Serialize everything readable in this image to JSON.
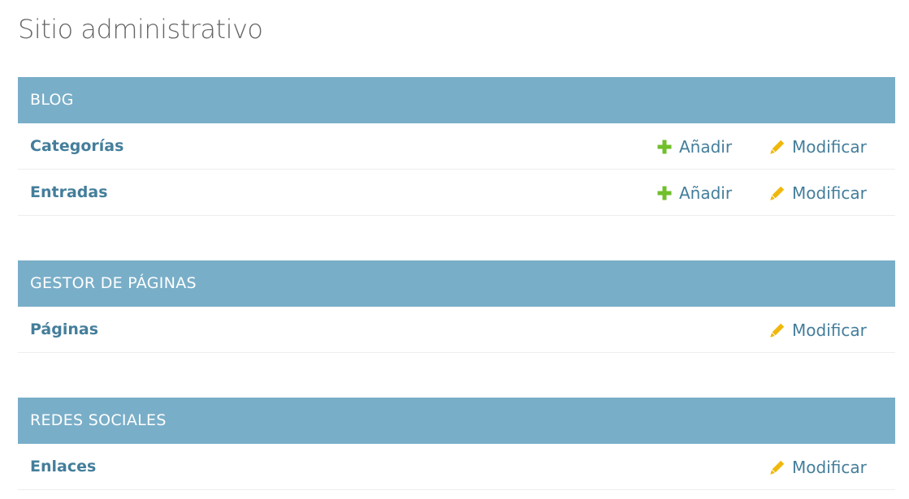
{
  "page": {
    "title": "Sitio administrativo"
  },
  "icons": {
    "add": "plus-icon",
    "change": "pencil-icon"
  },
  "colors": {
    "header_bg": "#79aec8",
    "header_text": "#ffffff",
    "link": "#447e9b",
    "add_icon": "#70bf2b",
    "change_icon": "#efb80b",
    "title": "#666666"
  },
  "modules": [
    {
      "name": "BLOG",
      "models": [
        {
          "name": "Categorías",
          "add_label": "Añadir",
          "change_label": "Modificar"
        },
        {
          "name": "Entradas",
          "add_label": "Añadir",
          "change_label": "Modificar"
        }
      ]
    },
    {
      "name": "GESTOR DE PÁGINAS",
      "models": [
        {
          "name": "Páginas",
          "change_label": "Modificar"
        }
      ]
    },
    {
      "name": "REDES SOCIALES",
      "models": [
        {
          "name": "Enlaces",
          "change_label": "Modificar"
        }
      ]
    }
  ]
}
